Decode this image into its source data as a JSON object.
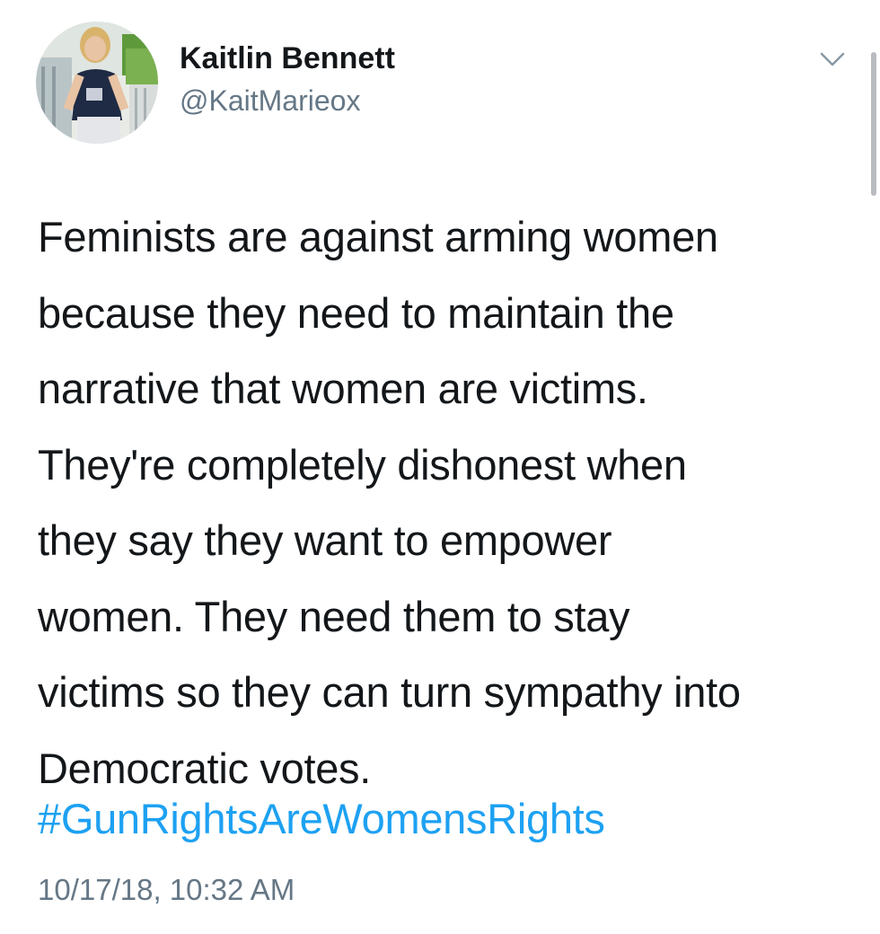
{
  "author": {
    "display_name": "Kaitlin Bennett",
    "handle": "@KaitMarieox"
  },
  "tweet": {
    "lines": [
      "Feminists are against arming women",
      "because they need to maintain the",
      "narrative that women are victims.",
      "They're completely dishonest when",
      "they say they want to empower",
      "women. They need them to stay",
      "victims so they can turn sympathy into",
      "Democratic votes."
    ],
    "hashtag": "#GunRightsAreWomensRights",
    "timestamp": "10/17/18, 10:32 AM"
  },
  "colors": {
    "text": "#14171a",
    "secondary": "#657786",
    "link": "#1da1f2",
    "background": "#ffffff"
  },
  "icons": {
    "menu": "chevron-down-icon"
  }
}
